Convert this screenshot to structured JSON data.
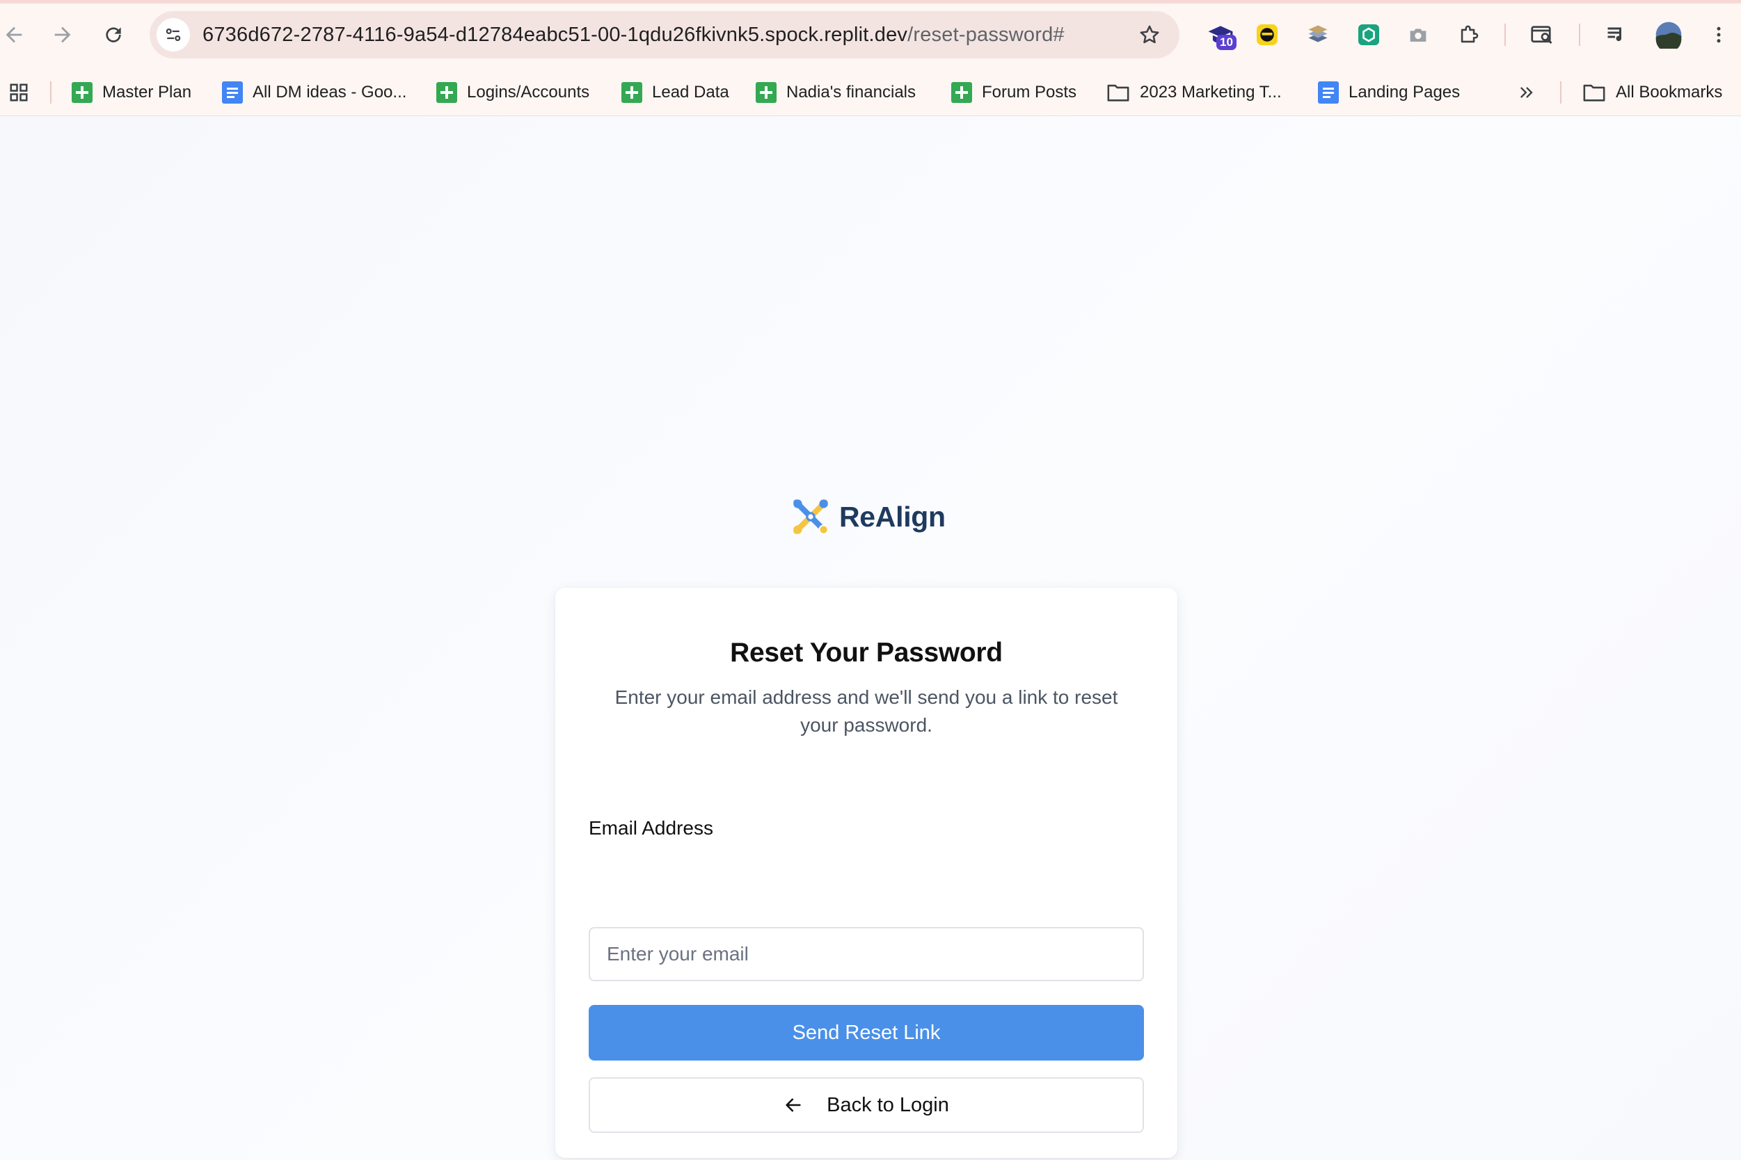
{
  "browser": {
    "url_host": "6736d672-2787-4116-9a54-d12784eabc51-00-1qdu26fkivnk5.spock.replit.dev",
    "url_path": "/reset-password#",
    "extension_badge": "10",
    "bookmarks": [
      {
        "label": "Master Plan",
        "icon": "sheet"
      },
      {
        "label": "All DM ideas - Goo...",
        "icon": "doc"
      },
      {
        "label": "Logins/Accounts",
        "icon": "sheet"
      },
      {
        "label": "Lead Data",
        "icon": "sheet"
      },
      {
        "label": "Nadia's financials",
        "icon": "sheet"
      },
      {
        "label": "Forum Posts",
        "icon": "sheet"
      },
      {
        "label": "2023 Marketing T...",
        "icon": "folder"
      },
      {
        "label": "Landing Pages",
        "icon": "doc"
      }
    ],
    "all_bookmarks_label": "All Bookmarks"
  },
  "brand": {
    "name": "ReAlign",
    "colors": {
      "blue": "#4a90e8",
      "yellow": "#f5c542",
      "text": "#1e3a5f"
    }
  },
  "card": {
    "title": "Reset Your Password",
    "subtitle": "Enter your email address and we'll send you a link to reset your password.",
    "email_label": "Email Address",
    "email_placeholder": "Enter your email",
    "email_value": "",
    "submit_label": "Send Reset Link",
    "back_label": "Back to Login"
  },
  "colors": {
    "primary_button": "#4a90e8",
    "chrome_background": "#fdf6f3"
  }
}
